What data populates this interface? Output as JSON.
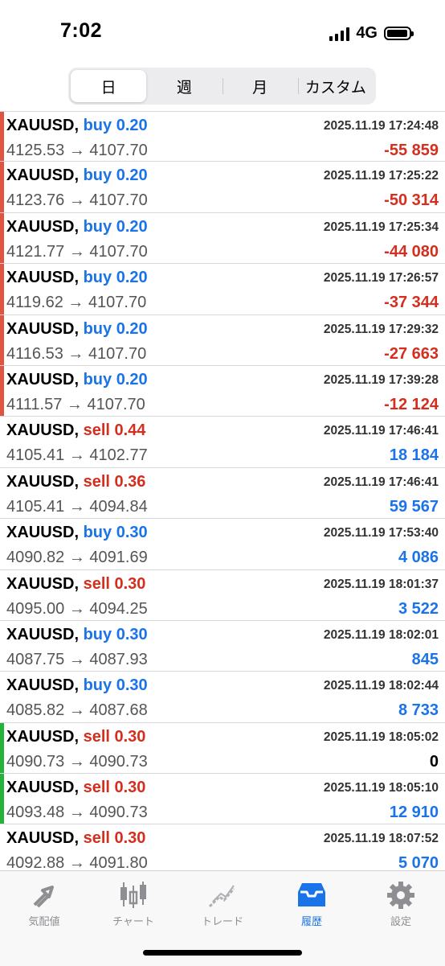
{
  "status": {
    "time": "7:02",
    "network": "4G"
  },
  "tabs": [
    {
      "label": "日",
      "active": true
    },
    {
      "label": "週",
      "active": false
    },
    {
      "label": "月",
      "active": false
    },
    {
      "label": "カスタム",
      "active": false
    }
  ],
  "arrow": "→",
  "trades": [
    {
      "symbol": "XAUUSD,",
      "side": "buy",
      "volume": "0.20",
      "datetime": "2025.11.19 17:24:48",
      "open": "4125.53",
      "close": "4107.70",
      "profit": "-55 859",
      "marker": "red"
    },
    {
      "symbol": "XAUUSD,",
      "side": "buy",
      "volume": "0.20",
      "datetime": "2025.11.19 17:25:22",
      "open": "4123.76",
      "close": "4107.70",
      "profit": "-50 314",
      "marker": "red"
    },
    {
      "symbol": "XAUUSD,",
      "side": "buy",
      "volume": "0.20",
      "datetime": "2025.11.19 17:25:34",
      "open": "4121.77",
      "close": "4107.70",
      "profit": "-44 080",
      "marker": "red"
    },
    {
      "symbol": "XAUUSD,",
      "side": "buy",
      "volume": "0.20",
      "datetime": "2025.11.19 17:26:57",
      "open": "4119.62",
      "close": "4107.70",
      "profit": "-37 344",
      "marker": "red"
    },
    {
      "symbol": "XAUUSD,",
      "side": "buy",
      "volume": "0.20",
      "datetime": "2025.11.19 17:29:32",
      "open": "4116.53",
      "close": "4107.70",
      "profit": "-27 663",
      "marker": "red"
    },
    {
      "symbol": "XAUUSD,",
      "side": "buy",
      "volume": "0.20",
      "datetime": "2025.11.19 17:39:28",
      "open": "4111.57",
      "close": "4107.70",
      "profit": "-12 124",
      "marker": "red"
    },
    {
      "symbol": "XAUUSD,",
      "side": "sell",
      "volume": "0.44",
      "datetime": "2025.11.19 17:46:41",
      "open": "4105.41",
      "close": "4102.77",
      "profit": "18 184",
      "marker": "none"
    },
    {
      "symbol": "XAUUSD,",
      "side": "sell",
      "volume": "0.36",
      "datetime": "2025.11.19 17:46:41",
      "open": "4105.41",
      "close": "4094.84",
      "profit": "59 567",
      "marker": "none"
    },
    {
      "symbol": "XAUUSD,",
      "side": "buy",
      "volume": "0.30",
      "datetime": "2025.11.19 17:53:40",
      "open": "4090.82",
      "close": "4091.69",
      "profit": "4 086",
      "marker": "none"
    },
    {
      "symbol": "XAUUSD,",
      "side": "sell",
      "volume": "0.30",
      "datetime": "2025.11.19 18:01:37",
      "open": "4095.00",
      "close": "4094.25",
      "profit": "3 522",
      "marker": "none"
    },
    {
      "symbol": "XAUUSD,",
      "side": "buy",
      "volume": "0.30",
      "datetime": "2025.11.19 18:02:01",
      "open": "4087.75",
      "close": "4087.93",
      "profit": "845",
      "marker": "none"
    },
    {
      "symbol": "XAUUSD,",
      "side": "buy",
      "volume": "0.30",
      "datetime": "2025.11.19 18:02:44",
      "open": "4085.82",
      "close": "4087.68",
      "profit": "8 733",
      "marker": "none"
    },
    {
      "symbol": "XAUUSD,",
      "side": "sell",
      "volume": "0.30",
      "datetime": "2025.11.19 18:05:02",
      "open": "4090.73",
      "close": "4090.73",
      "profit": "0",
      "marker": "green"
    },
    {
      "symbol": "XAUUSD,",
      "side": "sell",
      "volume": "0.30",
      "datetime": "2025.11.19 18:05:10",
      "open": "4093.48",
      "close": "4090.73",
      "profit": "12 910",
      "marker": "green"
    },
    {
      "symbol": "XAUUSD,",
      "side": "sell",
      "volume": "0.30",
      "datetime": "2025.11.19 18:07:52",
      "open": "4092.88",
      "close": "4091.80",
      "profit": "5 070",
      "marker": "none"
    }
  ],
  "tabbar": [
    {
      "label": "気配値",
      "icon": "quotes-arrows-icon",
      "active": false
    },
    {
      "label": "チャート",
      "icon": "candlestick-chart-icon",
      "active": false
    },
    {
      "label": "トレード",
      "icon": "trade-trend-icon",
      "active": false
    },
    {
      "label": "履歴",
      "icon": "history-inbox-icon",
      "active": true
    },
    {
      "label": "設定",
      "icon": "settings-gear-icon",
      "active": false
    }
  ],
  "colors": {
    "accent": "#1a73e8",
    "loss": "#d42e1e",
    "profit": "#1a73e8",
    "marker_red": "#e0533f",
    "marker_green": "#23b23a",
    "inactive": "#8e8e93"
  }
}
